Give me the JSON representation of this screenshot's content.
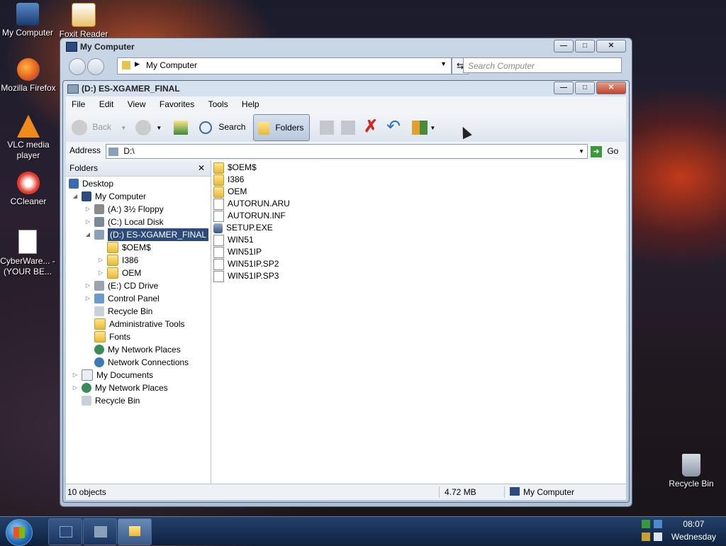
{
  "desktop": {
    "icons": [
      {
        "label": "My Computer"
      },
      {
        "label": "Foxit Reader"
      },
      {
        "label": "Mozilla Firefox"
      },
      {
        "label": "VLC media player"
      },
      {
        "label": "CCleaner"
      },
      {
        "label": "CyberWare... - (YOUR BE..."
      },
      {
        "label": "Recycle Bin"
      }
    ]
  },
  "back_window": {
    "title": "My Computer",
    "breadcrumb": "My Computer",
    "search_placeholder": "Search Computer"
  },
  "window": {
    "title": "(D:) ES-XGAMER_FINAL",
    "menu": [
      "File",
      "Edit",
      "View",
      "Favorites",
      "Tools",
      "Help"
    ],
    "toolbar": {
      "back": "Back",
      "search": "Search",
      "folders": "Folders"
    },
    "address_label": "Address",
    "address_value": "D:\\",
    "go_label": "Go",
    "folders_pane_title": "Folders",
    "tree": [
      {
        "label": "Desktop"
      },
      {
        "label": "My Computer"
      },
      {
        "label": "(A:) 3½ Floppy"
      },
      {
        "label": "(C:) Local Disk"
      },
      {
        "label": "(D:) ES-XGAMER_FINAL"
      },
      {
        "label": "$OEM$"
      },
      {
        "label": "I386"
      },
      {
        "label": "OEM"
      },
      {
        "label": "(E:) CD Drive"
      },
      {
        "label": "Control Panel"
      },
      {
        "label": "Recycle Bin"
      },
      {
        "label": "Administrative Tools"
      },
      {
        "label": "Fonts"
      },
      {
        "label": "My Network Places"
      },
      {
        "label": "Network Connections"
      },
      {
        "label": "My Documents"
      },
      {
        "label": "My Network Places"
      },
      {
        "label": "Recycle Bin"
      }
    ],
    "files": [
      {
        "name": "$OEM$",
        "type": "folder"
      },
      {
        "name": "I386",
        "type": "folder"
      },
      {
        "name": "OEM",
        "type": "folder"
      },
      {
        "name": "AUTORUN.ARU",
        "type": "file"
      },
      {
        "name": "AUTORUN.INF",
        "type": "file"
      },
      {
        "name": "SETUP.EXE",
        "type": "exe"
      },
      {
        "name": "WIN51",
        "type": "file"
      },
      {
        "name": "WIN51IP",
        "type": "file"
      },
      {
        "name": "WIN51IP.SP2",
        "type": "file"
      },
      {
        "name": "WIN51IP.SP3",
        "type": "file"
      }
    ],
    "status": {
      "count": "10 objects",
      "size": "4.72 MB",
      "location": "My Computer"
    }
  },
  "taskbar": {
    "time": "08:07",
    "day": "Wednesday"
  }
}
